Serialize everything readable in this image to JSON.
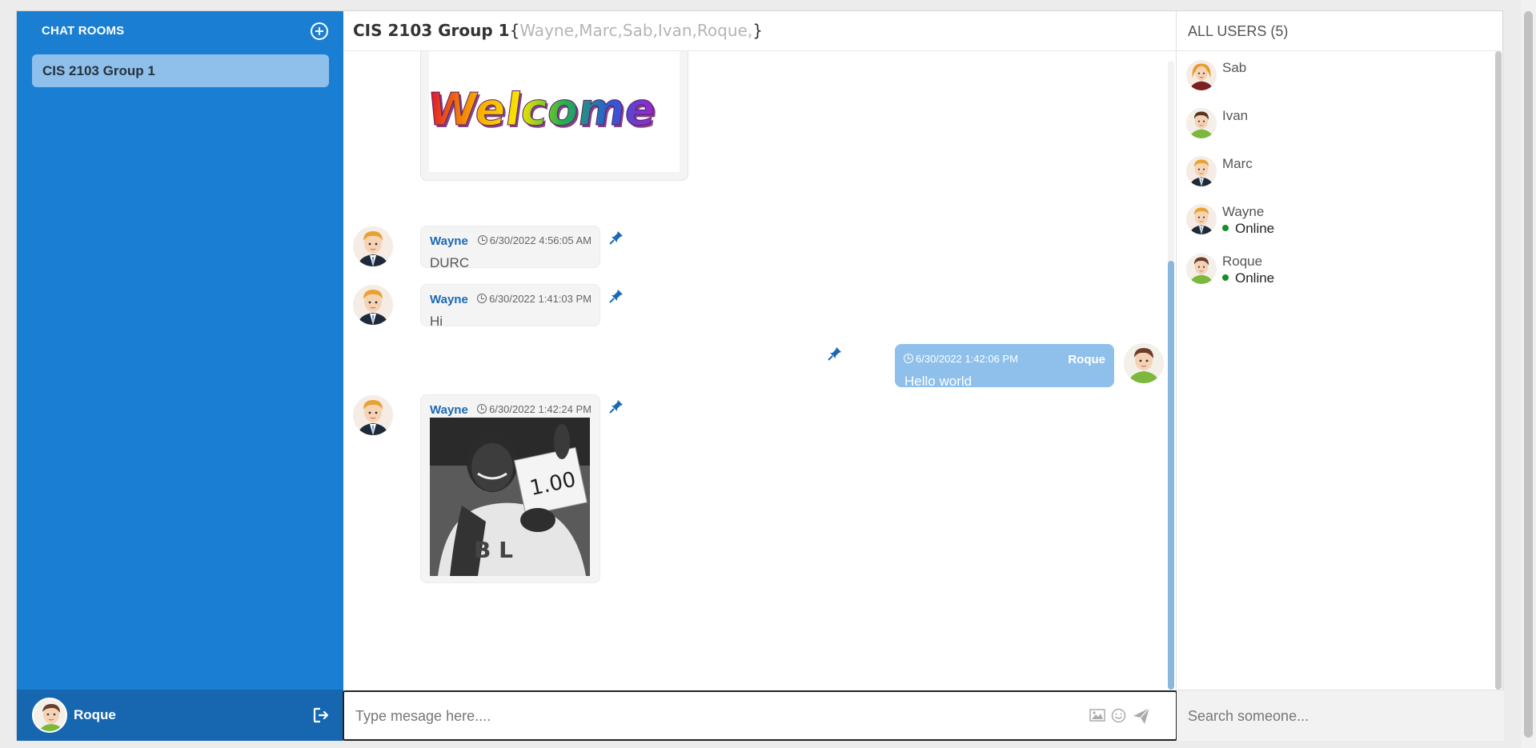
{
  "sidebar": {
    "title": "CHAT ROOMS",
    "rooms": [
      {
        "label": "CIS 2103 Group 1"
      }
    ],
    "current_user": "Roque"
  },
  "chat": {
    "room_name": "CIS 2103 Group 1",
    "brace_open": "{",
    "members": "Wayne,Marc,Sab,Ivan,Roque,",
    "brace_close": "}",
    "welcome_text": "Welcome",
    "messages": [
      {
        "sender": "Wayne",
        "time": "6/30/2022 4:56:05 AM",
        "text": "DURC"
      },
      {
        "sender": "Wayne",
        "time": "6/30/2022 1:41:03 PM",
        "text": "Hi"
      },
      {
        "sender": "Roque",
        "time": "6/30/2022 1:42:06 PM",
        "text": "Hello world"
      },
      {
        "sender": "Wayne",
        "time": "6/30/2022 1:42:24 PM",
        "photo_sign": "1.00"
      }
    ],
    "input_placeholder": "Type mesage here...."
  },
  "users": {
    "header": "ALL USERS (5)",
    "list": [
      {
        "name": "Sab",
        "status": ""
      },
      {
        "name": "Ivan",
        "status": ""
      },
      {
        "name": "Marc",
        "status": ""
      },
      {
        "name": "Wayne",
        "status": "Online"
      },
      {
        "name": "Roque",
        "status": "Online"
      }
    ],
    "search_placeholder": "Search someone..."
  },
  "colors": {
    "sidebar": "#1a7fd3",
    "sidebar_footer": "#1767b0",
    "active_room": "#8ec0eb",
    "my_bubble": "#8ec0eb",
    "sender_name": "#1a69b4",
    "online_dot": "#1a8c2a"
  },
  "icons": [
    "add-room-icon",
    "logout-icon",
    "pin-icon",
    "clock-icon",
    "image-icon",
    "emoji-icon",
    "send-icon"
  ]
}
